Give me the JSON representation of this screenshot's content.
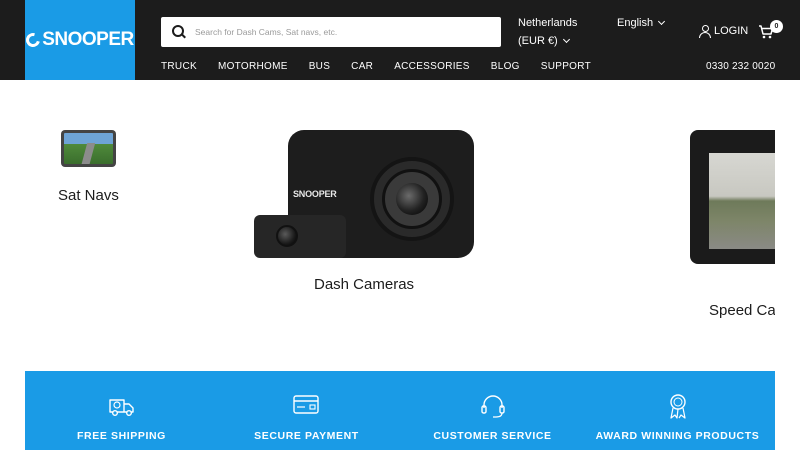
{
  "header": {
    "logo_text": "SNOOPER",
    "search_placeholder": "Search for Dash Cams, Sat navs, etc.",
    "country": "Netherlands",
    "currency": "(EUR €)",
    "language": "English",
    "login_label": "LOGIN",
    "cart_count": "0",
    "phone": "0330 232 0020",
    "nav": [
      "TRUCK",
      "MOTORHOME",
      "BUS",
      "CAR",
      "ACCESSORIES",
      "BLOG",
      "SUPPORT"
    ]
  },
  "categories": {
    "satnavs": "Sat Navs",
    "dashcams": "Dash Cameras",
    "speedcams": "Speed Ca",
    "dashcam_brand": "SNOOPER"
  },
  "features": [
    {
      "title": "FREE SHIPPING",
      "icon": "delivery-truck-icon"
    },
    {
      "title": "SECURE PAYMENT",
      "icon": "credit-card-icon"
    },
    {
      "title": "CUSTOMER SERVICE",
      "icon": "headset-icon"
    },
    {
      "title": "AWARD WINNING PRODUCTS",
      "icon": "award-ribbon-icon"
    }
  ],
  "colors": {
    "brand_blue": "#1a9be6",
    "header_bg": "#1c1c1c",
    "text": "#1c1c1c"
  }
}
